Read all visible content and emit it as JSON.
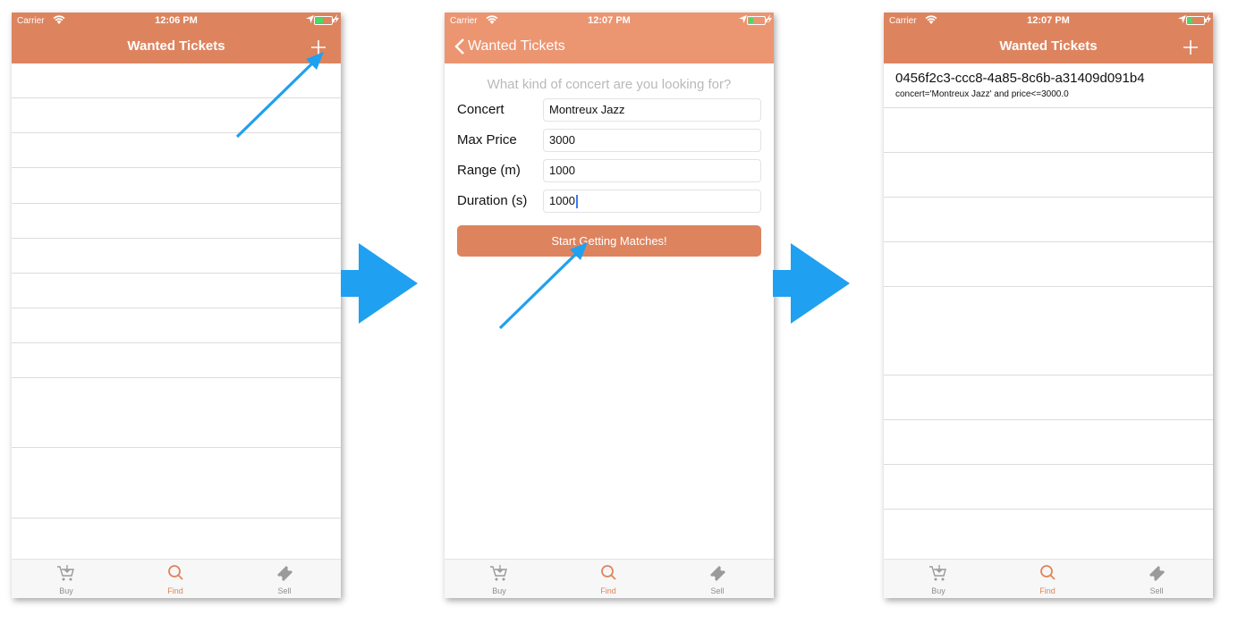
{
  "colors": {
    "nav_bg_1": "#dd845f",
    "nav_bg_2": "#ec9571",
    "nav_bg_3": "#dd845f",
    "accent": "#e2835a",
    "arrow_blue": "#20a0f0",
    "battery_green": "#4cd964"
  },
  "status": {
    "carrier": "Carrier",
    "time1": "12:06 PM",
    "time2": "12:07 PM",
    "time3": "12:07 PM"
  },
  "screen1": {
    "title": "Wanted Tickets",
    "add_icon": "plus-icon"
  },
  "screen2": {
    "back_label": "Wanted Tickets",
    "question": "What kind of concert are you looking for?",
    "fields": [
      {
        "label": "Concert",
        "value": "Montreux Jazz"
      },
      {
        "label": "Max Price",
        "value": "3000"
      },
      {
        "label": "Range (m)",
        "value": "1000"
      },
      {
        "label": "Duration (s)",
        "value": "1000"
      }
    ],
    "start_button": "Start Getting Matches!"
  },
  "screen3": {
    "title": "Wanted Tickets",
    "result_id": "0456f2c3-ccc8-4a85-8c6b-a31409d091b4",
    "result_query": "concert='Montreux Jazz' and price<=3000.0"
  },
  "tabs": [
    {
      "label": "Buy",
      "icon": "cart-icon"
    },
    {
      "label": "Find",
      "icon": "search-icon"
    },
    {
      "label": "Sell",
      "icon": "ticket-icon"
    }
  ]
}
